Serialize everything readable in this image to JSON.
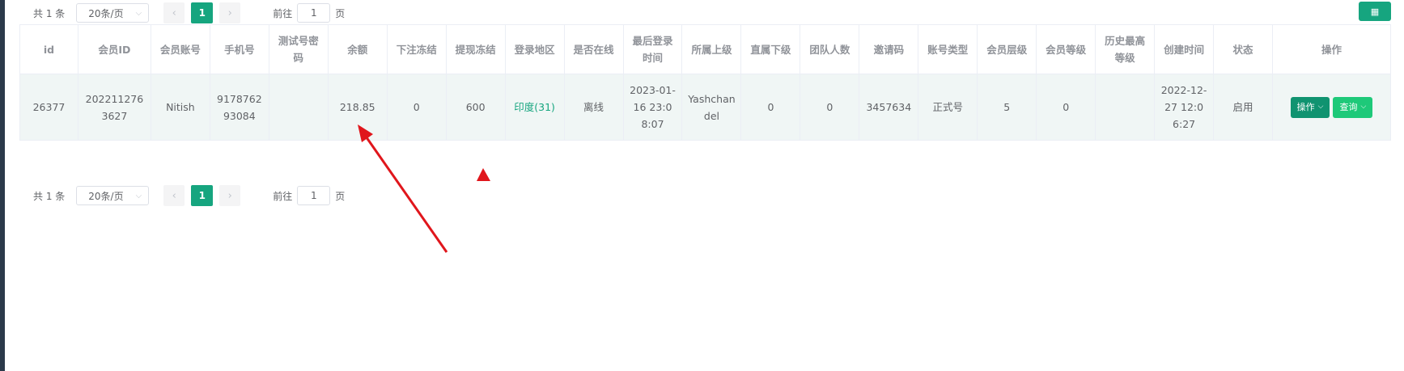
{
  "pagination_top": {
    "total": "共 1 条",
    "page_size": "20条/页",
    "current_page": "1",
    "goto_label": "前往",
    "goto_value": "1",
    "page_unit": "页"
  },
  "pagination_bottom": {
    "total": "共 1 条",
    "page_size": "20条/页",
    "current_page": "1",
    "goto_label": "前往",
    "goto_value": "1",
    "page_unit": "页"
  },
  "toolbar": {
    "grid_icon": "grid-icon",
    "grid_glyph": "▦"
  },
  "table": {
    "headers": [
      "id",
      "会员ID",
      "会员账号",
      "手机号",
      "测试号密码",
      "余额",
      "下注冻结",
      "提现冻结",
      "登录地区",
      "是否在线",
      "最后登录时间",
      "所属上级",
      "直属下级",
      "团队人数",
      "邀请码",
      "账号类型",
      "会员层级",
      "会员等级",
      "历史最高等级",
      "创建时间",
      "状态",
      "操作"
    ],
    "rows": [
      {
        "id": "26377",
        "member_id": "2022112763627",
        "account": "Nitish",
        "phone": "917876293084",
        "test_password": "",
        "balance": "218.85",
        "bet_frozen": "0",
        "withdraw_frozen": "600",
        "login_region": "印度(31)",
        "online": "离线",
        "last_login": "2023-01-16 23:08:07",
        "parent": "Yashchandel",
        "direct_sub": "0",
        "team_size": "0",
        "invite_code": "3457634",
        "account_type": "正式号",
        "member_tier": "5",
        "member_level": "0",
        "max_level": "",
        "created": "2022-12-27 12:06:27",
        "status": "启用",
        "action_btn": "操作",
        "query_btn": "查询"
      }
    ]
  },
  "annotation": {
    "color": "#e0161c"
  },
  "colors": {
    "accent": "#16a57f",
    "row_bg": "#f0f6f5",
    "btn_light": "#1ec979"
  }
}
